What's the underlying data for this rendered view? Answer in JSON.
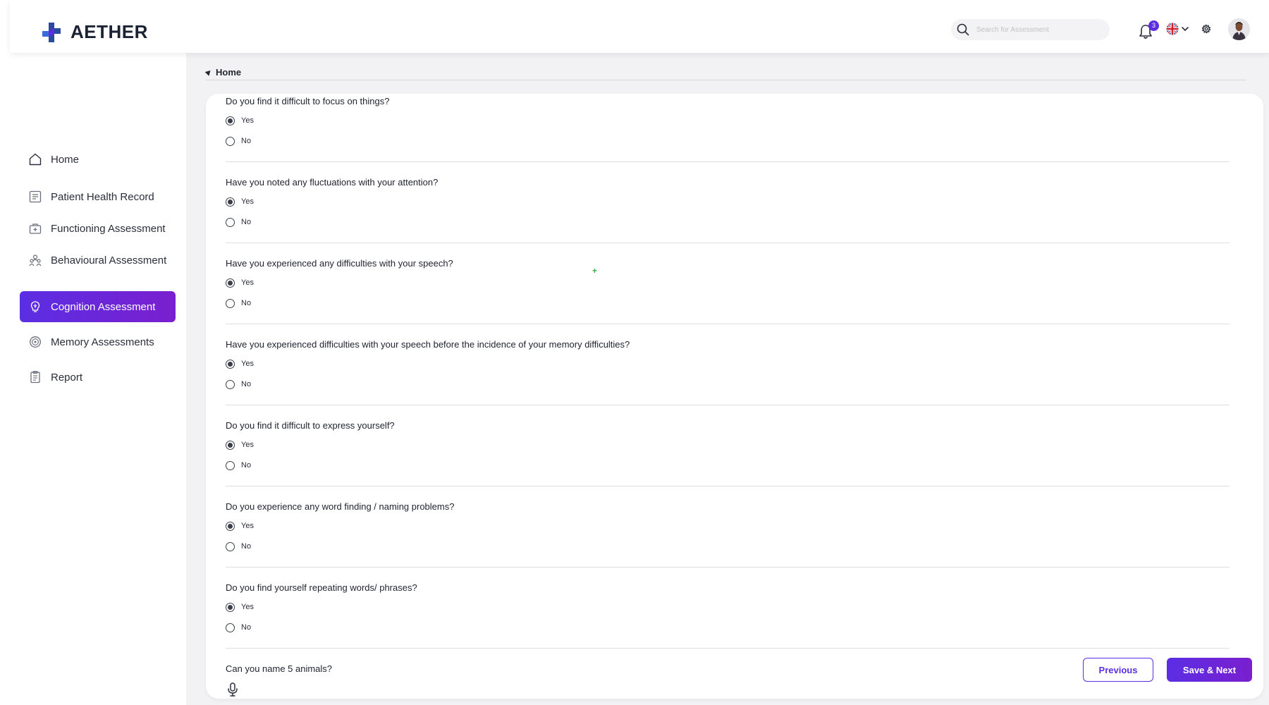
{
  "brand": {
    "name": "AETHER"
  },
  "header": {
    "search_placeholder": "Search for Assessment",
    "notification_count": "3",
    "language_icon": "uk-flag-icon"
  },
  "sidebar": {
    "items": [
      {
        "label": "Home",
        "icon": "home-icon",
        "active": false
      },
      {
        "label": "Patient Health Record",
        "icon": "record-icon",
        "active": false
      },
      {
        "label": "Functioning Assessment",
        "icon": "medkit-icon",
        "active": false
      },
      {
        "label": "Behavioural Assessment",
        "icon": "people-icon",
        "active": false
      },
      {
        "label": "Cognition Assessment",
        "icon": "brain-icon",
        "active": true
      },
      {
        "label": "Memory Assessments",
        "icon": "memory-icon",
        "active": false
      },
      {
        "label": "Report",
        "icon": "report-icon",
        "active": false
      }
    ]
  },
  "breadcrumb": {
    "label": "Home"
  },
  "questions": [
    {
      "text": "Do you find it difficult to focus on things?",
      "options": [
        "Yes",
        "No"
      ],
      "selected": "Yes"
    },
    {
      "text": "Have you noted any fluctuations with your attention?",
      "options": [
        "Yes",
        "No"
      ],
      "selected": "Yes"
    },
    {
      "text": "Have you experienced any difficulties with your speech?",
      "options": [
        "Yes",
        "No"
      ],
      "selected": "Yes"
    },
    {
      "text": "Have you experienced difficulties with your speech before the incidence of your memory difficulties?",
      "options": [
        "Yes",
        "No"
      ],
      "selected": "Yes"
    },
    {
      "text": "Do you find it difficult to express yourself?",
      "options": [
        "Yes",
        "No"
      ],
      "selected": "Yes"
    },
    {
      "text": "Do you experience any word finding / naming problems?",
      "options": [
        "Yes",
        "No"
      ],
      "selected": "Yes"
    },
    {
      "text": "Do you find yourself repeating words/ phrases?",
      "options": [
        "Yes",
        "No"
      ],
      "selected": "Yes"
    }
  ],
  "voice_question": {
    "text": "Can you name 5 animals?"
  },
  "buttons": {
    "previous": "Previous",
    "save_next": "Save & Next"
  },
  "colors": {
    "accent": "#5b2ee3",
    "accent_end": "#7a1fcf",
    "background": "#f2f2f4"
  }
}
